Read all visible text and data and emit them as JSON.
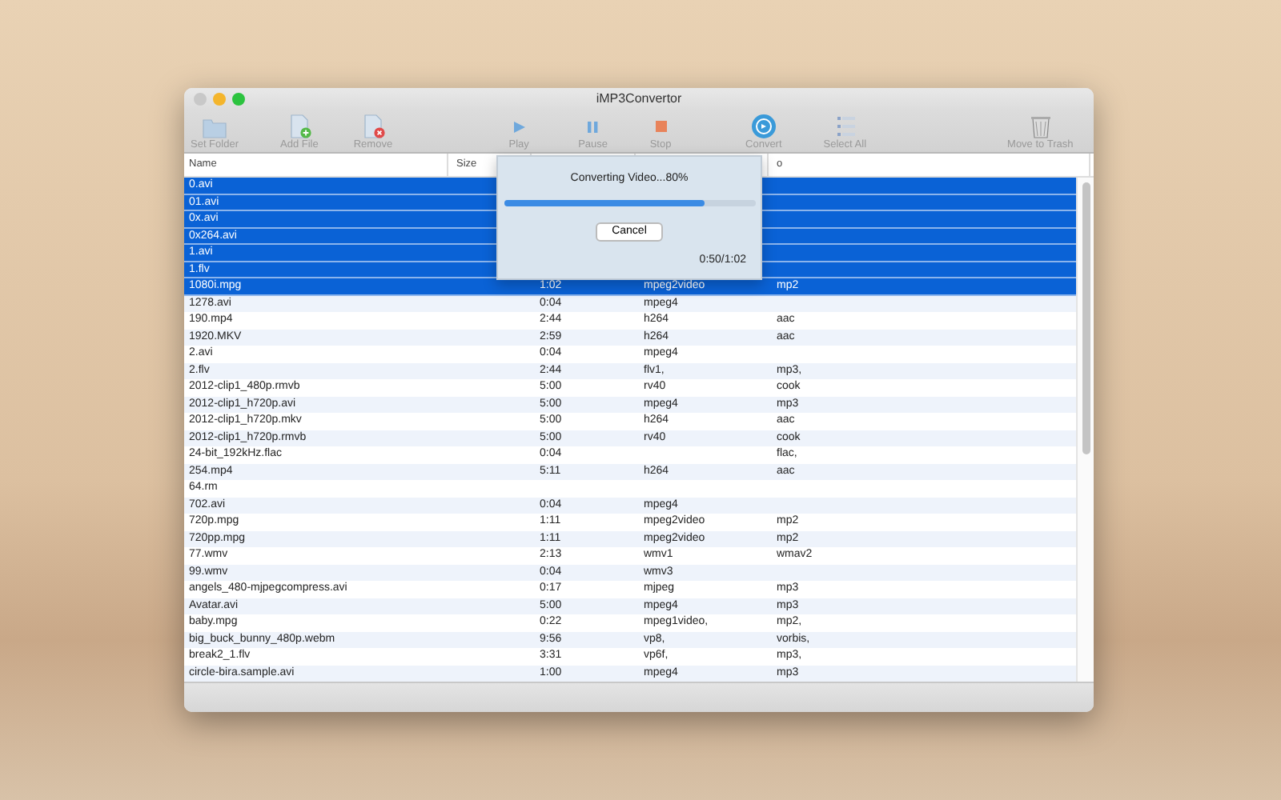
{
  "window": {
    "title": "iMP3Convertor"
  },
  "toolbar": [
    {
      "label": "Set Folder",
      "kind": "folder"
    },
    {
      "label": "Add File",
      "kind": "add"
    },
    {
      "label": "Remove",
      "kind": "remove"
    },
    {
      "label": "Play",
      "kind": "play"
    },
    {
      "label": "Pause",
      "kind": "pause"
    },
    {
      "label": "Stop",
      "kind": "stop"
    },
    {
      "label": "Convert",
      "kind": "convert"
    },
    {
      "label": "Select All",
      "kind": "selectall"
    },
    {
      "label": "Move to Trash",
      "kind": "trash"
    }
  ],
  "table": {
    "columns": [
      {
        "label": "Name"
      },
      {
        "label": "Size"
      },
      {},
      {},
      {
        "label": "o"
      }
    ],
    "rows": [
      {
        "cells": [
          "0.avi"
        ],
        "selected": true
      },
      {
        "cells": [
          "01.avi"
        ],
        "selected": true
      },
      {
        "cells": [
          "0x.avi"
        ],
        "selected": true
      },
      {
        "cells": [
          "0x264.avi"
        ],
        "selected": true
      },
      {
        "cells": [
          "1.avi"
        ],
        "selected": true
      },
      {
        "cells": [
          "1.flv"
        ],
        "selected": true
      },
      {
        "cells": [
          "1080i.mpg",
          "",
          "1:02",
          "mpeg2video",
          "mp2"
        ],
        "selected": true
      },
      {
        "cells": [
          "1278.avi",
          "",
          "0:04",
          "mpeg4",
          ""
        ],
        "selected": false
      },
      {
        "cells": [
          "190.mp4",
          "",
          "2:44",
          "h264",
          "aac"
        ],
        "selected": false
      },
      {
        "cells": [
          "1920.MKV",
          "",
          "2:59",
          "h264",
          "aac"
        ],
        "selected": false
      },
      {
        "cells": [
          "2.avi",
          "",
          "0:04",
          "mpeg4",
          ""
        ],
        "selected": false
      },
      {
        "cells": [
          "2.flv",
          "",
          "2:44",
          "flv1,",
          "mp3,"
        ],
        "selected": false
      },
      {
        "cells": [
          "2012-clip1_480p.rmvb",
          "",
          "5:00",
          "rv40",
          "cook"
        ],
        "selected": false
      },
      {
        "cells": [
          "2012-clip1_h720p.avi",
          "",
          "5:00",
          "mpeg4",
          "mp3"
        ],
        "selected": false
      },
      {
        "cells": [
          "2012-clip1_h720p.mkv",
          "",
          "5:00",
          "h264",
          "aac"
        ],
        "selected": false
      },
      {
        "cells": [
          "2012-clip1_h720p.rmvb",
          "",
          "5:00",
          "rv40",
          "cook"
        ],
        "selected": false
      },
      {
        "cells": [
          "24-bit_192kHz.flac",
          "",
          "0:04",
          "",
          "flac,"
        ],
        "selected": false
      },
      {
        "cells": [
          "254.mp4",
          "",
          "5:11",
          "h264",
          "aac"
        ],
        "selected": false
      },
      {
        "cells": [
          "64.rm"
        ],
        "selected": false
      },
      {
        "cells": [
          "702.avi",
          "",
          "0:04",
          "mpeg4",
          ""
        ],
        "selected": false
      },
      {
        "cells": [
          "720p.mpg",
          "",
          "1:11",
          "mpeg2video",
          "mp2"
        ],
        "selected": false
      },
      {
        "cells": [
          "720pp.mpg",
          "",
          "1:11",
          "mpeg2video",
          "mp2"
        ],
        "selected": false
      },
      {
        "cells": [
          "77.wmv",
          "",
          "2:13",
          "wmv1",
          "wmav2"
        ],
        "selected": false
      },
      {
        "cells": [
          "99.wmv",
          "",
          "0:04",
          "wmv3",
          ""
        ],
        "selected": false
      },
      {
        "cells": [
          "angels_480-mjpegcompress.avi",
          "",
          "0:17",
          "mjpeg",
          "mp3"
        ],
        "selected": false
      },
      {
        "cells": [
          "Avatar.avi",
          "",
          "5:00",
          "mpeg4",
          "mp3"
        ],
        "selected": false
      },
      {
        "cells": [
          "baby.mpg",
          "",
          "0:22",
          "mpeg1video,",
          "mp2,"
        ],
        "selected": false
      },
      {
        "cells": [
          "big_buck_bunny_480p.webm",
          "",
          "9:56",
          "vp8,",
          "vorbis,"
        ],
        "selected": false
      },
      {
        "cells": [
          "break2_1.flv",
          "",
          "3:31",
          "vp6f,",
          "mp3,"
        ],
        "selected": false
      },
      {
        "cells": [
          "circle-bira.sample.avi",
          "",
          "1:00",
          "mpeg4",
          "mp3"
        ],
        "selected": false
      }
    ]
  },
  "dialog": {
    "title": "Converting Video...80%",
    "level": 0.8,
    "button": "Cancel",
    "time": "0:50/1:02"
  }
}
